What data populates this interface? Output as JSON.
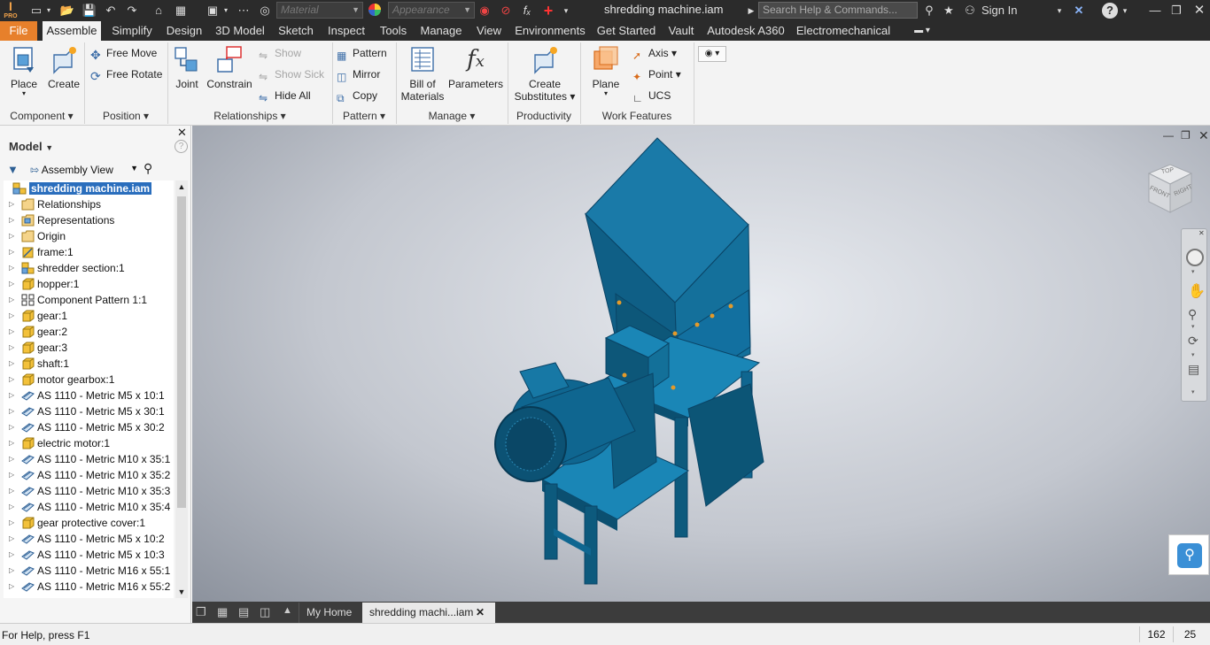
{
  "window": {
    "logo_text": "PRO",
    "title": "shredding machine.iam",
    "search_placeholder": "Search Help & Commands...",
    "sign_in": "Sign In",
    "material_combo": "Material",
    "appearance_combo": "Appearance"
  },
  "menu": {
    "file": "File",
    "tabs": [
      "Assemble",
      "Simplify",
      "Design",
      "3D Model",
      "Sketch",
      "Inspect",
      "Tools",
      "Manage",
      "View",
      "Environments",
      "Get Started",
      "Vault",
      "Autodesk A360",
      "Electromechanical"
    ],
    "active_tab": "Assemble"
  },
  "ribbon": {
    "place": "Place",
    "create": "Create",
    "free_move": "Free Move",
    "free_rotate": "Free Rotate",
    "joint": "Joint",
    "constrain": "Constrain",
    "show": "Show",
    "show_sick": "Show Sick",
    "hide_all": "Hide All",
    "pattern": "Pattern",
    "mirror": "Mirror",
    "copy": "Copy",
    "bom_line1": "Bill of",
    "bom_line2": "Materials",
    "parameters": "Parameters",
    "create_subs_line1": "Create",
    "create_subs_line2": "Substitutes",
    "plane": "Plane",
    "axis": "Axis",
    "point": "Point",
    "ucs": "UCS",
    "panels": {
      "component": "Component",
      "position": "Position",
      "relationships": "Relationships",
      "pattern": "Pattern",
      "manage": "Manage",
      "productivity": "Productivity",
      "work_features": "Work Features"
    }
  },
  "browser": {
    "title": "Model",
    "view": "Assembly View",
    "root": "shredding machine.iam",
    "items": [
      {
        "label": "Relationships",
        "icon": "folder-icon"
      },
      {
        "label": "Representations",
        "icon": "representations-icon"
      },
      {
        "label": "Origin",
        "icon": "folder-icon"
      },
      {
        "label": "frame:1",
        "icon": "frame-icon"
      },
      {
        "label": "shredder section:1",
        "icon": "subassembly-icon"
      },
      {
        "label": "hopper:1",
        "icon": "part-icon"
      },
      {
        "label": "Component Pattern 1:1",
        "icon": "pattern-icon"
      },
      {
        "label": "gear:1",
        "icon": "part-icon"
      },
      {
        "label": "gear:2",
        "icon": "part-icon"
      },
      {
        "label": "gear:3",
        "icon": "part-icon"
      },
      {
        "label": "shaft:1",
        "icon": "part-icon"
      },
      {
        "label": "motor gearbox:1",
        "icon": "part-icon"
      },
      {
        "label": "AS 1110 - Metric M5 x 10:1",
        "icon": "bolt-icon"
      },
      {
        "label": "AS 1110 - Metric M5 x 30:1",
        "icon": "bolt-icon"
      },
      {
        "label": "AS 1110 - Metric M5 x 30:2",
        "icon": "bolt-icon"
      },
      {
        "label": "electric motor:1",
        "icon": "part-icon"
      },
      {
        "label": "AS 1110 - Metric M10 x 35:1",
        "icon": "bolt-icon"
      },
      {
        "label": "AS 1110 - Metric M10 x 35:2",
        "icon": "bolt-icon"
      },
      {
        "label": "AS 1110 - Metric M10 x 35:3",
        "icon": "bolt-icon"
      },
      {
        "label": "AS 1110 - Metric M10 x 35:4",
        "icon": "bolt-icon"
      },
      {
        "label": "gear protective cover:1",
        "icon": "part-icon"
      },
      {
        "label": "AS 1110 - Metric M5 x 10:2",
        "icon": "bolt-icon"
      },
      {
        "label": "AS 1110 - Metric M5 x 10:3",
        "icon": "bolt-icon"
      },
      {
        "label": "AS 1110 - Metric M16 x 55:1",
        "icon": "bolt-icon"
      },
      {
        "label": "AS 1110 - Metric M16 x 55:2",
        "icon": "bolt-icon"
      }
    ]
  },
  "viewcube": {
    "front": "FRONT",
    "right": "RIGHT",
    "top": "TOP"
  },
  "doctabs": {
    "home": "My Home",
    "active": "shredding machi...iam"
  },
  "status": {
    "help": "For Help, press F1",
    "count1": "162",
    "count2": "25"
  },
  "colors": {
    "model": "#0f5f86",
    "file_tab": "#e7802b",
    "selection": "#2a6ebd"
  }
}
